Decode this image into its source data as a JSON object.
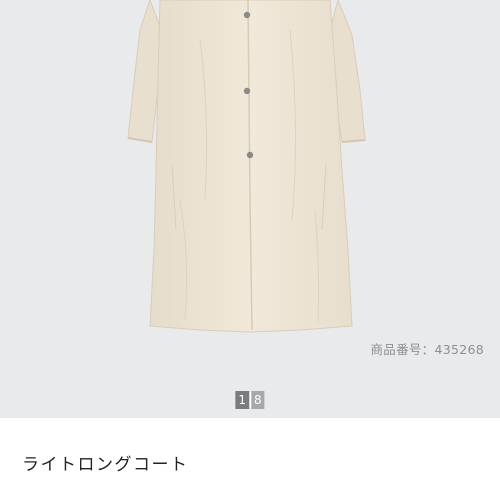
{
  "product": {
    "code_text": "商品番号：435268",
    "name": "ライトロングコート"
  },
  "gallery": {
    "current_page": "1",
    "total_pages": "8"
  },
  "colors": {
    "gallery_bg": "#e9eaec",
    "coat": "#efe6d6"
  }
}
